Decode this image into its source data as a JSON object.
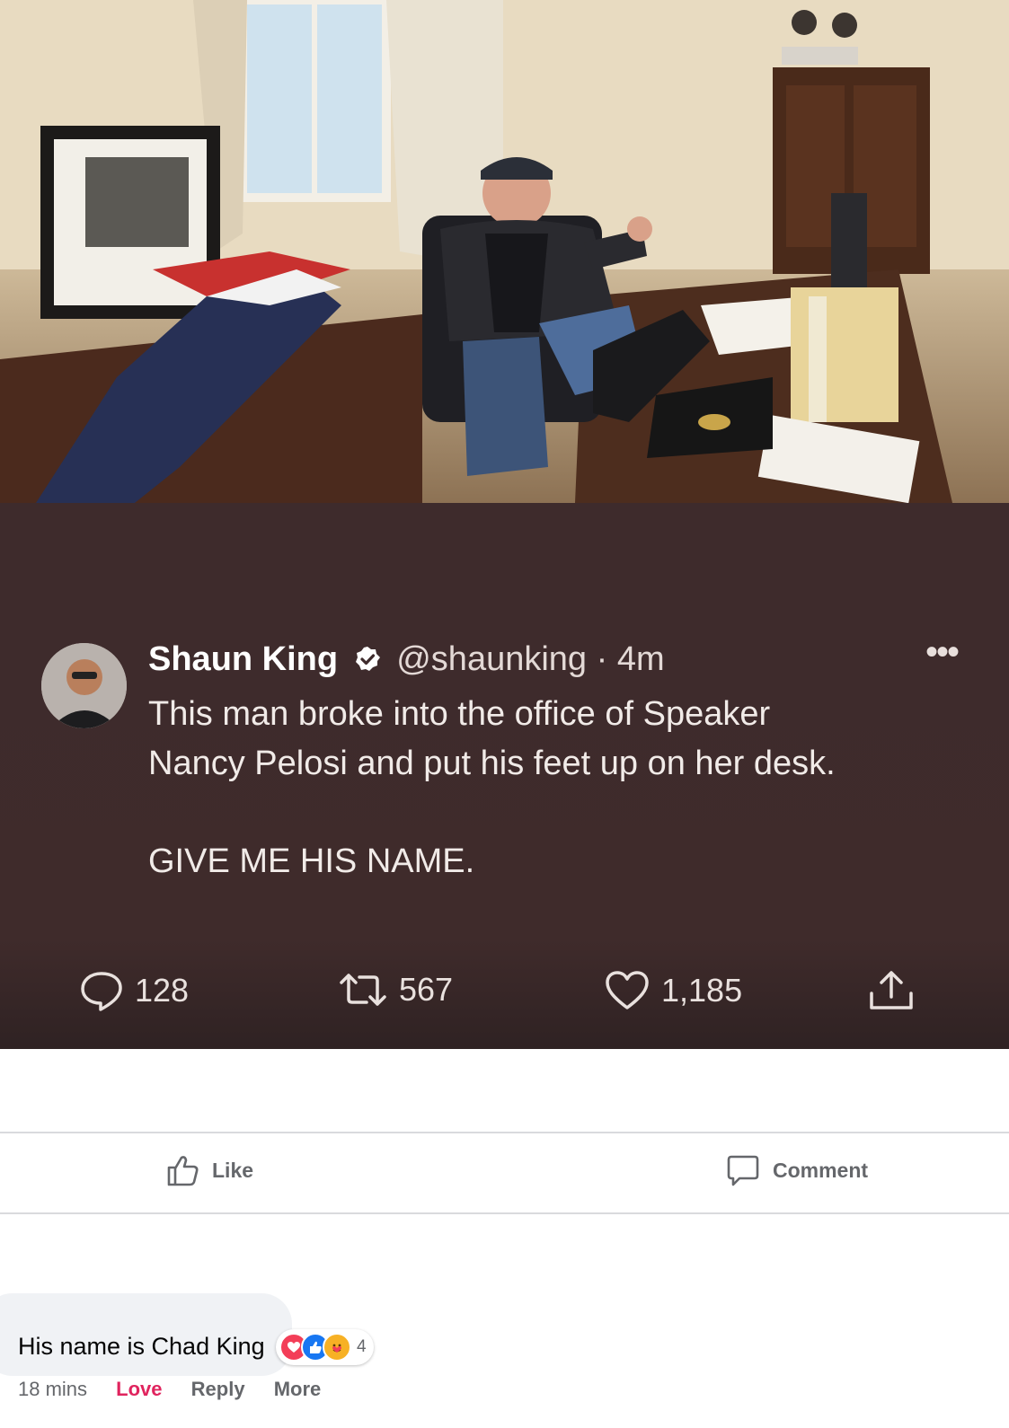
{
  "tweet": {
    "author_name": "Shaun King",
    "handle": "@shaunking",
    "separator": "·",
    "time": "4m",
    "text_line1": "This man broke into the office of Speaker",
    "text_line2": "Nancy Pelosi and put his feet up on her desk.",
    "text_shout": "GIVE ME HIS NAME.",
    "replies": "128",
    "retweets": "567",
    "likes": "1,185",
    "more_glyph": "•••"
  },
  "facebook": {
    "like_label": "Like",
    "comment_label": "Comment"
  },
  "comment": {
    "text": "His name is Chad King",
    "reaction_count": "4",
    "time": "18 mins",
    "love_label": "Love",
    "reply_label": "Reply",
    "more_label": "More"
  },
  "colors": {
    "tweet_bg": "#3e2b2c",
    "verified": "#ffffff",
    "love": "#e0245e",
    "fb_like_blue": "#1877f2"
  }
}
